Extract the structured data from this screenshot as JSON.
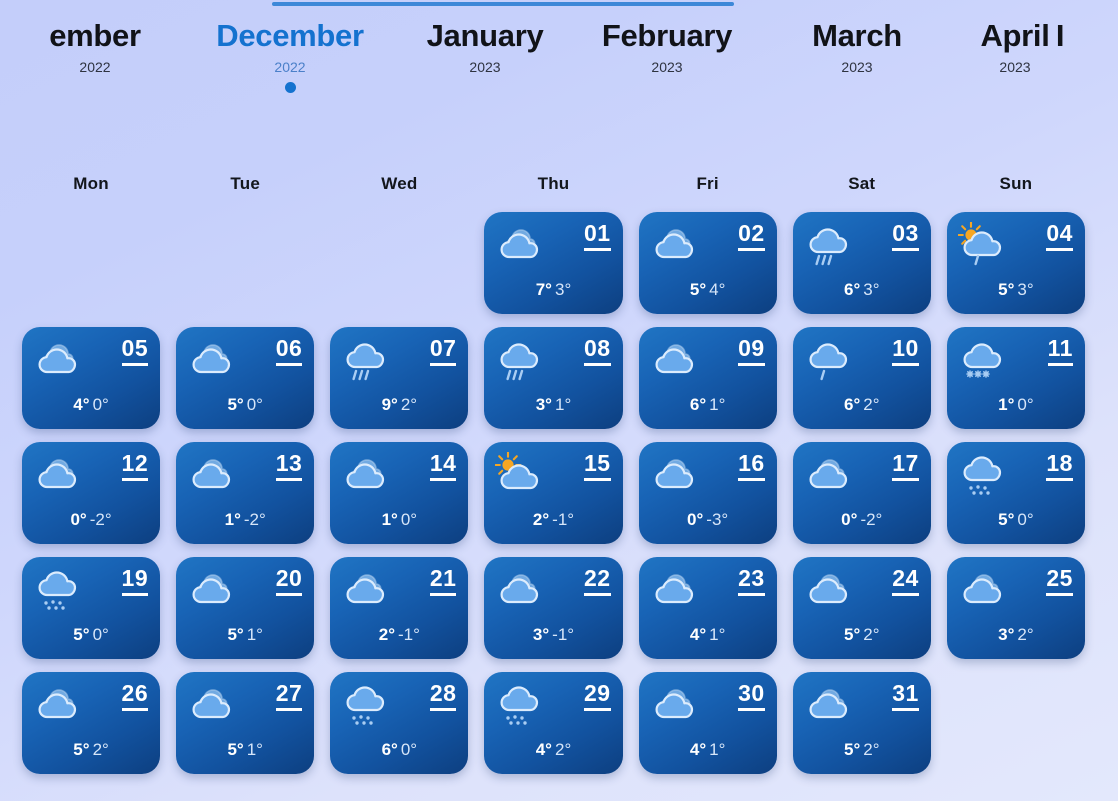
{
  "months": [
    {
      "name": "ember",
      "year": "2022",
      "active": false
    },
    {
      "name": "December",
      "year": "2022",
      "active": true
    },
    {
      "name": "January",
      "year": "2023",
      "active": false
    },
    {
      "name": "February",
      "year": "2023",
      "active": false
    },
    {
      "name": "March",
      "year": "2023",
      "active": false
    },
    {
      "name": "April",
      "year": "2023",
      "active": false
    },
    {
      "name": "I",
      "year": "",
      "active": false
    }
  ],
  "weekdays": [
    "Mon",
    "Tue",
    "Wed",
    "Thu",
    "Fri",
    "Sat",
    "Sun"
  ],
  "leading_blank_days": 3,
  "colors": {
    "accent": "#1472cf",
    "card_top": "#2075c4",
    "card_bottom": "#0d3f80",
    "page_background": "#ccd5fb",
    "sun": "#f5a623"
  },
  "days": [
    {
      "day": "01",
      "icon": "cloudy-icon",
      "high": "7°",
      "low": "3°"
    },
    {
      "day": "02",
      "icon": "cloudy-icon",
      "high": "5°",
      "low": "4°"
    },
    {
      "day": "03",
      "icon": "rain-icon",
      "high": "6°",
      "low": "3°"
    },
    {
      "day": "04",
      "icon": "sun-cloud-rain-icon",
      "high": "5°",
      "low": "3°"
    },
    {
      "day": "05",
      "icon": "cloudy-icon",
      "high": "4°",
      "low": "0°"
    },
    {
      "day": "06",
      "icon": "cloudy-icon",
      "high": "5°",
      "low": "0°"
    },
    {
      "day": "07",
      "icon": "rain-icon",
      "high": "9°",
      "low": "2°"
    },
    {
      "day": "08",
      "icon": "rain-icon",
      "high": "3°",
      "low": "1°"
    },
    {
      "day": "09",
      "icon": "cloudy-icon",
      "high": "6°",
      "low": "1°"
    },
    {
      "day": "10",
      "icon": "light-rain-icon",
      "high": "6°",
      "low": "2°"
    },
    {
      "day": "11",
      "icon": "snow-icon",
      "high": "1°",
      "low": "0°"
    },
    {
      "day": "12",
      "icon": "cloudy-icon",
      "high": "0°",
      "low": "-2°"
    },
    {
      "day": "13",
      "icon": "cloudy-icon",
      "high": "1°",
      "low": "-2°"
    },
    {
      "day": "14",
      "icon": "cloudy-icon",
      "high": "1°",
      "low": "0°"
    },
    {
      "day": "15",
      "icon": "sun-cloud-icon",
      "high": "2°",
      "low": "-1°"
    },
    {
      "day": "16",
      "icon": "cloudy-icon",
      "high": "0°",
      "low": "-3°"
    },
    {
      "day": "17",
      "icon": "cloudy-icon",
      "high": "0°",
      "low": "-2°"
    },
    {
      "day": "18",
      "icon": "sleet-icon",
      "high": "5°",
      "low": "0°"
    },
    {
      "day": "19",
      "icon": "sleet-icon",
      "high": "5°",
      "low": "0°"
    },
    {
      "day": "20",
      "icon": "cloudy-icon",
      "high": "5°",
      "low": "1°"
    },
    {
      "day": "21",
      "icon": "cloudy-icon",
      "high": "2°",
      "low": "-1°"
    },
    {
      "day": "22",
      "icon": "cloudy-icon",
      "high": "3°",
      "low": "-1°"
    },
    {
      "day": "23",
      "icon": "cloudy-icon",
      "high": "4°",
      "low": "1°"
    },
    {
      "day": "24",
      "icon": "cloudy-icon",
      "high": "5°",
      "low": "2°"
    },
    {
      "day": "25",
      "icon": "cloudy-icon",
      "high": "3°",
      "low": "2°"
    },
    {
      "day": "26",
      "icon": "cloudy-icon",
      "high": "5°",
      "low": "2°"
    },
    {
      "day": "27",
      "icon": "cloudy-icon",
      "high": "5°",
      "low": "1°"
    },
    {
      "day": "28",
      "icon": "sleet-icon",
      "high": "6°",
      "low": "0°"
    },
    {
      "day": "29",
      "icon": "sleet-icon",
      "high": "4°",
      "low": "2°"
    },
    {
      "day": "30",
      "icon": "cloudy-icon",
      "high": "4°",
      "low": "1°"
    },
    {
      "day": "31",
      "icon": "cloudy-icon",
      "high": "5°",
      "low": "2°"
    }
  ]
}
